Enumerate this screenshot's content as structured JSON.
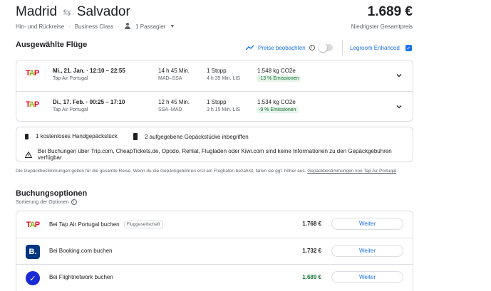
{
  "header": {
    "origin": "Madrid",
    "destination": "Salvador",
    "trip_type": "Hin- und Rückreise",
    "cabin": "Business Class",
    "passengers": "1 Passagier",
    "total_price": "1.689 €",
    "price_caption": "Niedrigster Gesamtpreis"
  },
  "selected": {
    "title": "Ausgewählte Flüge",
    "watch_label": "Preise beobachten",
    "legroom_label": "Legroom Enhanced"
  },
  "flights": [
    {
      "date_time": "Mi., 21. Jan.  ·  12:10 – 22:55",
      "airline": "Tap Air Portugal",
      "duration": "14 h 45 Min.",
      "route": "MAD–SSA",
      "stops": "1 Stopp",
      "layover": "4 h 35 Min. LIS",
      "co2": "1.548 kg CO2e",
      "emissions": "-13 % Emissionen"
    },
    {
      "date_time": "Di., 17. Feb.  ·  00:25 – 17:10",
      "airline": "Tap Air Portugal",
      "duration": "12 h 45 Min.",
      "route": "SSA–MAD",
      "stops": "1 Stopp",
      "layover": "3 h 15 Min. LIS",
      "co2": "1.534 kg CO2e",
      "emissions": "-9 % Emissionen"
    }
  ],
  "baggage": {
    "carry_on": "1 kostenloses Handgepäckstück",
    "checked": "2 aufgegebene Gepäckstücke inbegriffen",
    "warning": "Bei Buchungen über Trip.com, CheapTickets.de, Opodo, Rehlat, Flugladen oder Kiwi.com sind keine Informationen zu den Gepäckgebühren verfügbar"
  },
  "note": {
    "text": "Die Gepäckbestimmungen gelten für die gesamte Reise. Wenn du die Gepäckgebühren erst am Flughafen bezahlst, fallen sie ggf. höher aus. ",
    "link": "Gepäckbestimmungen von Tap Air Portugal"
  },
  "booking": {
    "title": "Buchungsoptionen",
    "sort_label": "Sortierung der Optionen",
    "button_label": "Weiter",
    "options": [
      {
        "name": "Bei Tap Air Portugal buchen",
        "chip": "Fluggesellschaft",
        "price": "1.768 €"
      },
      {
        "name": "Bei Booking.com buchen",
        "chip": "",
        "price": "1.732 €"
      },
      {
        "name": "Bei Flightnetwork buchen",
        "chip": "",
        "price": "1.689 €"
      }
    ]
  },
  "colors": {
    "accent": "#1a73e8",
    "green": "#137333",
    "tap_red": "#e4002b",
    "tap_green": "#7ab800",
    "booking_blue": "#003580",
    "flightnetwork_blue": "#1a2bd4"
  }
}
